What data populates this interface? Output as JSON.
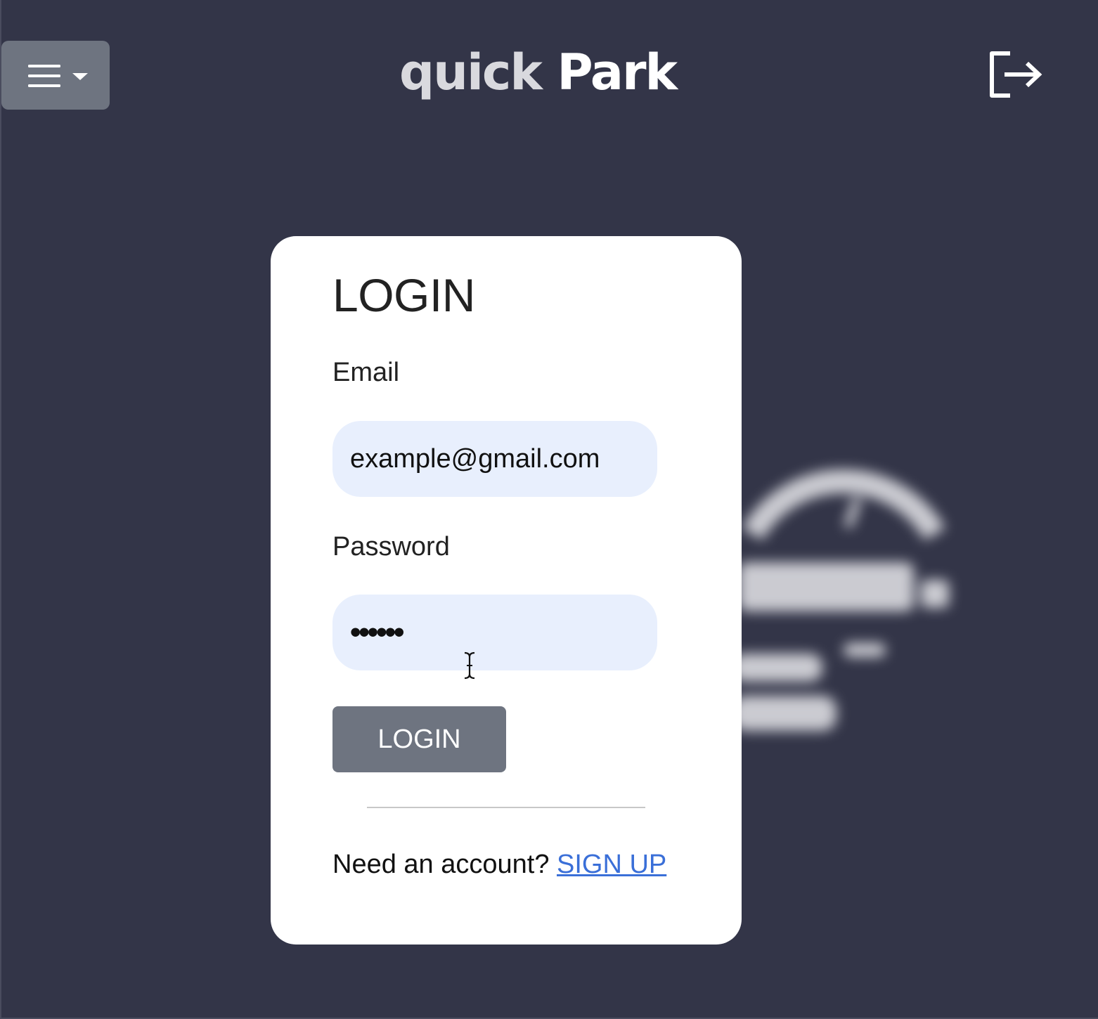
{
  "header": {
    "menu_icon": "hamburger-icon",
    "brand_part1": "quick",
    "brand_part2": "Park",
    "logout_icon": "logout-icon"
  },
  "login_card": {
    "title": "LOGIN",
    "email": {
      "label": "Email",
      "value": "example@gmail.com"
    },
    "password": {
      "label": "Password",
      "masked_value": "••••••"
    },
    "submit_label": "LOGIN",
    "signup_prompt": "Need an account?",
    "signup_link": "SIGN UP"
  },
  "colors": {
    "background": "#333548",
    "button_gray": "#6e7480",
    "input_bg": "#e8effd",
    "link_blue": "#3a6fd8"
  }
}
